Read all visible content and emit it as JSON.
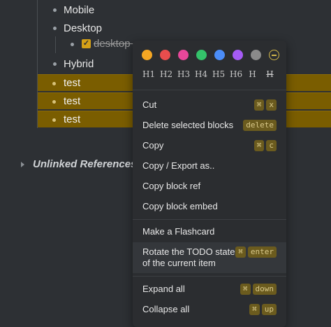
{
  "outline": {
    "items": [
      {
        "label": "Mobile"
      },
      {
        "label": "Desktop"
      },
      {
        "label": "desktop c"
      },
      {
        "label": "Hybrid"
      },
      {
        "label": "test"
      },
      {
        "label": "test"
      },
      {
        "label": "test"
      }
    ],
    "unlinked_references": "Unlinked References"
  },
  "menu": {
    "colors": [
      "#f5a623",
      "#e84d4d",
      "#e8479a",
      "#34c26a",
      "#4b8df8",
      "#a55bf5",
      "#8a8a8a"
    ],
    "clear_color_icon": "minus-circle-icon",
    "headings": [
      "H1",
      "H2",
      "H3",
      "H4",
      "H5",
      "H6",
      "H",
      "H"
    ],
    "items": [
      {
        "label": "Cut",
        "keys": [
          "⌘",
          "x"
        ]
      },
      {
        "label": "Delete selected blocks",
        "keys": [
          "delete"
        ]
      },
      {
        "label": "Copy",
        "keys": [
          "⌘",
          "c"
        ]
      },
      {
        "label": "Copy / Export as..",
        "keys": []
      },
      {
        "label": "Copy block ref",
        "keys": []
      },
      {
        "label": "Copy block embed",
        "keys": []
      },
      {
        "label": "Make a Flashcard",
        "keys": []
      },
      {
        "label": "Rotate the TODO state\nof the current item",
        "keys": [
          "⌘",
          "enter"
        ]
      },
      {
        "label": "Expand all",
        "keys": [
          "⌘",
          "down"
        ]
      },
      {
        "label": "Collapse all",
        "keys": [
          "⌘",
          "up"
        ]
      }
    ]
  }
}
